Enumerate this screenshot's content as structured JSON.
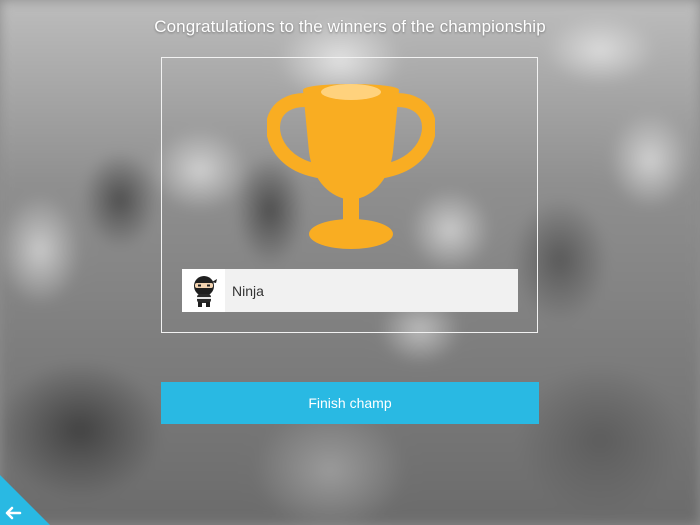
{
  "header": {
    "title": "Congratulations to the winners of the championship"
  },
  "winner": {
    "name": "Ninja",
    "avatar_icon": "ninja-icon"
  },
  "actions": {
    "finish_label": "Finish champ"
  },
  "colors": {
    "trophy": "#f9ad22",
    "button": "#29b9e3",
    "back_corner": "#29b9e3"
  },
  "icons": {
    "trophy": "trophy-icon",
    "back": "back-arrow-icon"
  }
}
